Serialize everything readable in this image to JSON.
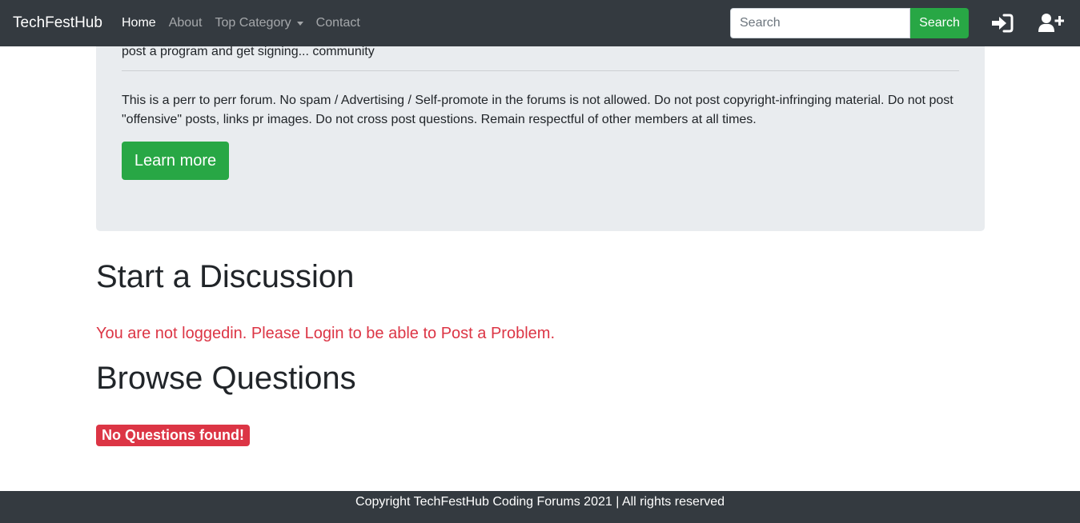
{
  "navbar": {
    "brand": "TechFestHub",
    "links": [
      "Home",
      "About",
      "Top Category",
      "Contact"
    ],
    "search": {
      "placeholder": "Search",
      "button": "Search"
    },
    "icons": {
      "login": "sign-in-icon",
      "signup": "user-plus-icon"
    }
  },
  "jumbotron": {
    "partial_line": "post a program and get signing... community",
    "rules": "This is a perr to perr forum. No spam / Advertising / Self-promote in the forums is not allowed. Do not post copyright-infringing material. Do not post \"offensive\" posts, links pr images. Do not cross post questions. Remain respectful of other members at all times.",
    "button": "Learn more"
  },
  "main": {
    "start_heading": "Start a Discussion",
    "login_warning": "You are not loggedin. Please Login to be able to Post a Problem.",
    "browse_heading": "Browse Questions",
    "empty_badge": "No Questions found!"
  },
  "footer": {
    "text": "Copyright TechFestHub Coding Forums 2021 | All rights reserved"
  },
  "colors": {
    "navbar": "#343a40",
    "accent_green": "#28a745",
    "danger": "#dc3545",
    "jumbotron": "#e9ecef"
  }
}
